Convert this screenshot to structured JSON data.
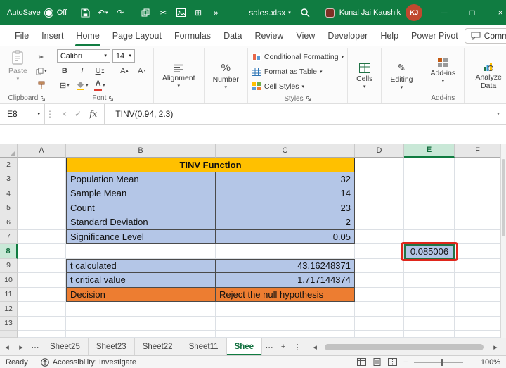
{
  "titlebar": {
    "autosave_label": "AutoSave",
    "autosave_state": "Off",
    "filename": "sales.xlsx",
    "user_name": "Kunal Jai Kaushik",
    "user_initials": "KJ"
  },
  "menubar": {
    "items": [
      "File",
      "Insert",
      "Home",
      "Page Layout",
      "Formulas",
      "Data",
      "Review",
      "View",
      "Developer",
      "Help",
      "Power Pivot"
    ],
    "active_item": "Home",
    "comments_label": "Comments"
  },
  "ribbon": {
    "paste_label": "Paste",
    "font_name": "Calibri",
    "font_size": "14",
    "bold": "B",
    "italic": "I",
    "underline": "U",
    "font_color_letter": "A",
    "grow_font": "A",
    "shrink_font": "A",
    "alignment_label": "Alignment",
    "number_label": "Number",
    "conditional_formatting_label": "Conditional Formatting",
    "format_as_table_label": "Format as Table",
    "cell_styles_label": "Cell Styles",
    "cells_label": "Cells",
    "editing_label": "Editing",
    "addins_label": "Add-ins",
    "analyze_data_label": "Analyze Data",
    "groups": {
      "clipboard": "Clipboard",
      "font": "Font",
      "styles": "Styles",
      "addins": "Add-ins"
    }
  },
  "formula_bar": {
    "name_box": "E8",
    "fx_label": "fx",
    "formula": "=TINV(0.94, 2.3)"
  },
  "grid": {
    "cols": [
      "A",
      "B",
      "C",
      "D",
      "E",
      "F"
    ],
    "rows": [
      "2",
      "3",
      "4",
      "5",
      "6",
      "7",
      "8",
      "9",
      "10",
      "11",
      "12",
      "13"
    ],
    "selected_cell": "E8"
  },
  "sheet": {
    "title": "TINV Function",
    "stats": [
      {
        "label": "Population Mean",
        "value": "32"
      },
      {
        "label": "Sample Mean",
        "value": "14"
      },
      {
        "label": "Count",
        "value": "23"
      },
      {
        "label": "Standard Deviation",
        "value": "2"
      },
      {
        "label": "Significance Level",
        "value": "0.05"
      }
    ],
    "results": [
      {
        "label": "t calculated",
        "value": "43.16248371"
      },
      {
        "label": "t critical value",
        "value": "1.717144374"
      }
    ],
    "decision_label": "Decision",
    "decision_value": "Reject the null hypothesis",
    "e8_value": "0.085006"
  },
  "tabs": {
    "items": [
      "Sheet25",
      "Sheet23",
      "Sheet22",
      "Sheet11"
    ],
    "active": "Shee"
  },
  "statusbar": {
    "mode": "Ready",
    "accessibility": "Accessibility: Investigate",
    "zoom": "100%"
  },
  "icons": {
    "caret": "▾",
    "caret_up": "▴",
    "cut": "✂",
    "undo": "↶",
    "redo": "↷",
    "overflow": "»",
    "vdots": "⋮",
    "hdots": "⋯",
    "close": "×",
    "check": "✓",
    "percent": "%",
    "borders": "⊞",
    "pencil": "✎",
    "minimize": "─",
    "maximize": "□",
    "tab_prev": "◂",
    "tab_next": "▸",
    "add_sheet": "+",
    "zoom_out": "−",
    "zoom_in": "+"
  },
  "colors": {
    "excel_green": "#107C41",
    "title_yellow": "#FFC000",
    "cell_blue": "#B4C6E7",
    "cell_orange": "#ED7D31",
    "annotation_red": "#E0261C",
    "avatar": "#C0492F"
  }
}
